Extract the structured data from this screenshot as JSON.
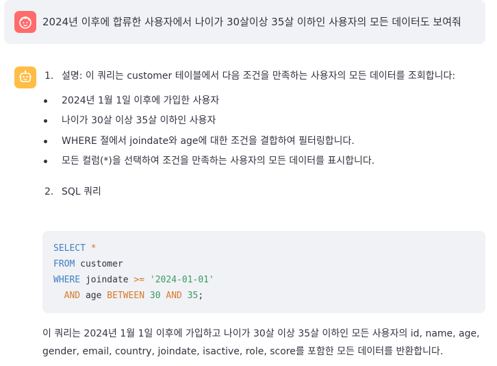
{
  "user_message": {
    "text": "2024년 이후에 합류한 사용자에서 나이가 30살이상 35살 이하인 사용자의 모든 데이터도 보여줘"
  },
  "assistant_message": {
    "items": [
      {
        "number": "1.",
        "text": "설명: 이 쿼리는 customer 테이블에서 다음 조건을 만족하는 사용자의 모든 데이터를 조회합니다:"
      },
      {
        "number": "2.",
        "text": "SQL 쿼리"
      }
    ],
    "bullets": [
      "2024년 1월 1일 이후에 가입한 사용자",
      "나이가 30살 이상 35살 이하인 사용자",
      "WHERE 절에서 joindate와 age에 대한 조건을 결합하여 필터링합니다.",
      "모든 컬럼(*)을 선택하여 조건을 만족하는 사용자의 모든 데이터를 표시합니다."
    ],
    "code": {
      "l1_kw": "SELECT",
      "l1_op": "*",
      "l2_kw": "FROM",
      "l2_text": "customer",
      "l3_kw": "WHERE",
      "l3_col": "joindate",
      "l3_op": ">=",
      "l3_str": "'2024-01-01'",
      "l4_kw": "AND",
      "l4_col": "age",
      "l4_op": "BETWEEN",
      "l4_n1": "30",
      "l4_kw2": "AND",
      "l4_n2": "35",
      "l4_end": ";"
    },
    "summary": "이 쿼리는 2024년 1월 1일 이후에 가입하고 나이가 30살 이상 35살 이하인 모든 사용자의 id, name, age, gender, email, country, joindate, isactive, role, score를 포함한 모든 데이터를 반환합니다."
  },
  "colors": {
    "user_avatar": "#ff6b6b",
    "bot_avatar": "#ffbd45",
    "keyword": "#3f7fbf",
    "operator": "#d97a2a",
    "string": "#3c9a5f"
  }
}
